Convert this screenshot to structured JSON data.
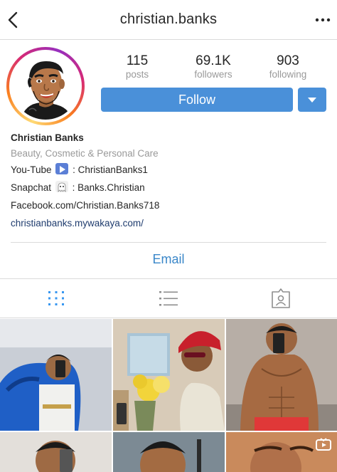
{
  "header": {
    "username": "christian.banks",
    "back_icon": "chevron-left-icon",
    "more_icon": "more-horizontal-icon"
  },
  "profile": {
    "stats": [
      {
        "value": "115",
        "label": "posts"
      },
      {
        "value": "69.1K",
        "label": "followers"
      },
      {
        "value": "903",
        "label": "following"
      }
    ],
    "follow_label": "Follow",
    "accent": "#4a90d9"
  },
  "bio": {
    "name": "Christian Banks",
    "category": "Beauty, Cosmetic & Personal Care",
    "youtube_prefix": "You-Tube",
    "youtube_handle": ": ChristianBanks1",
    "snapchat_prefix": "Snapchat",
    "snapchat_handle": ": Banks.Christian",
    "facebook": "Facebook.com/Christian.Banks718",
    "website": "christianbanks.mywakaya.com/"
  },
  "actions": {
    "email_label": "Email"
  },
  "tabs": [
    {
      "icon": "grid-icon",
      "active": true
    },
    {
      "icon": "list-icon",
      "active": false
    },
    {
      "icon": "tagged-icon",
      "active": false
    }
  ],
  "grid": {
    "photos": [
      {
        "desc": "selfie-blue-jacket"
      },
      {
        "desc": "red-cap-flowers"
      },
      {
        "desc": "shirtless-mirror"
      },
      {
        "desc": "selfie-close"
      },
      {
        "desc": "face-close"
      },
      {
        "desc": "face-igtv"
      }
    ]
  }
}
